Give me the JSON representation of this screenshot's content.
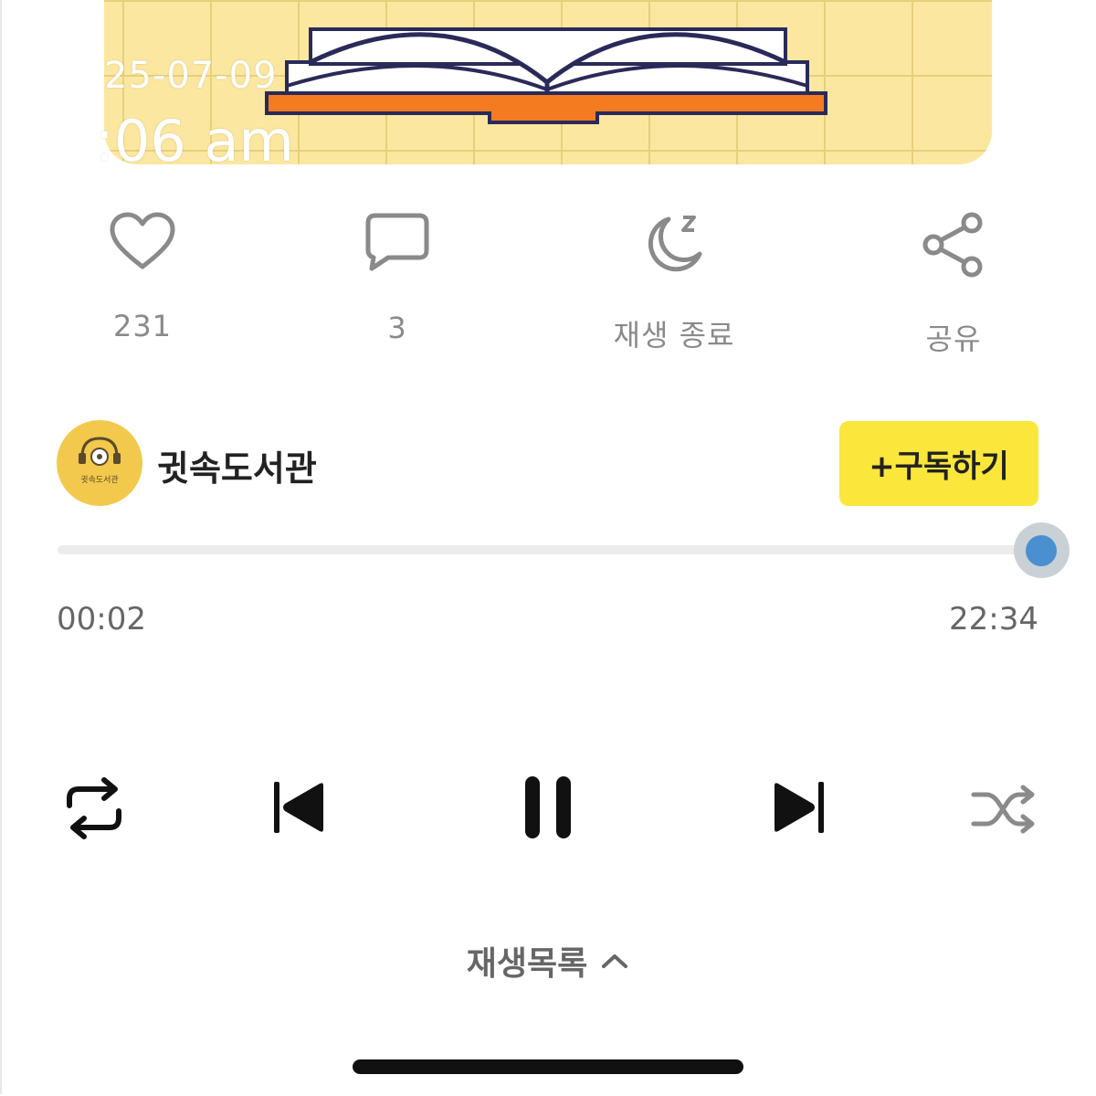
{
  "cover": {
    "overlay_date": "25-07-09",
    "overlay_time": ":06 am"
  },
  "actions": [
    {
      "name": "like",
      "icon": "heart-icon",
      "label": "231"
    },
    {
      "name": "comment",
      "icon": "speech-bubble-icon",
      "label": "3"
    },
    {
      "name": "sleep-timer",
      "icon": "moon-icon",
      "label": "재생 종료"
    },
    {
      "name": "share",
      "icon": "share-icon",
      "label": "공유"
    }
  ],
  "channel": {
    "name": "귓속도서관",
    "avatar_text": "귓속도서관",
    "subscribe_label": "+구독하기"
  },
  "player": {
    "elapsed": "00:02",
    "total": "22:34",
    "progress": 0.99,
    "controls": [
      "repeat-icon",
      "previous-icon",
      "pause-icon",
      "next-icon",
      "shuffle-icon"
    ]
  },
  "playlist": {
    "label": "재생목록",
    "icon": "chevron-up-icon"
  },
  "colors": {
    "accent_yellow": "#fbe63c",
    "progress_blue": "#4a90d0",
    "cover_bg": "#fbe7a0",
    "book_orange": "#f47b20",
    "book_outline": "#2a2a5a"
  }
}
